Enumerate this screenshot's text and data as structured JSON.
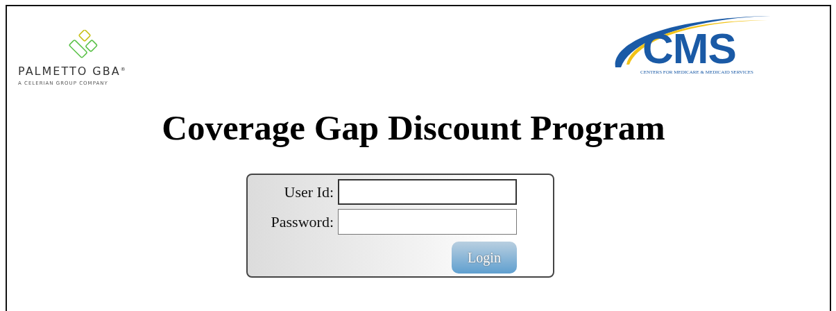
{
  "header": {
    "left_logo": {
      "name": "PALMETTO GBA$^{®}$",
      "tagline": "A CELERIAN GROUP COMPANY"
    },
    "right_logo": {
      "name": "CMS",
      "tagline": "CENTERS FOR MEDICARE & MEDICAID SERVICES"
    }
  },
  "title": "Coverage Gap Discount Program",
  "login_form": {
    "fields": [
      {
        "label": "User Id:"
      },
      {
        "label": "Password:",
        "kind": "password"
      }
    ],
    "button": "Login"
  }
}
